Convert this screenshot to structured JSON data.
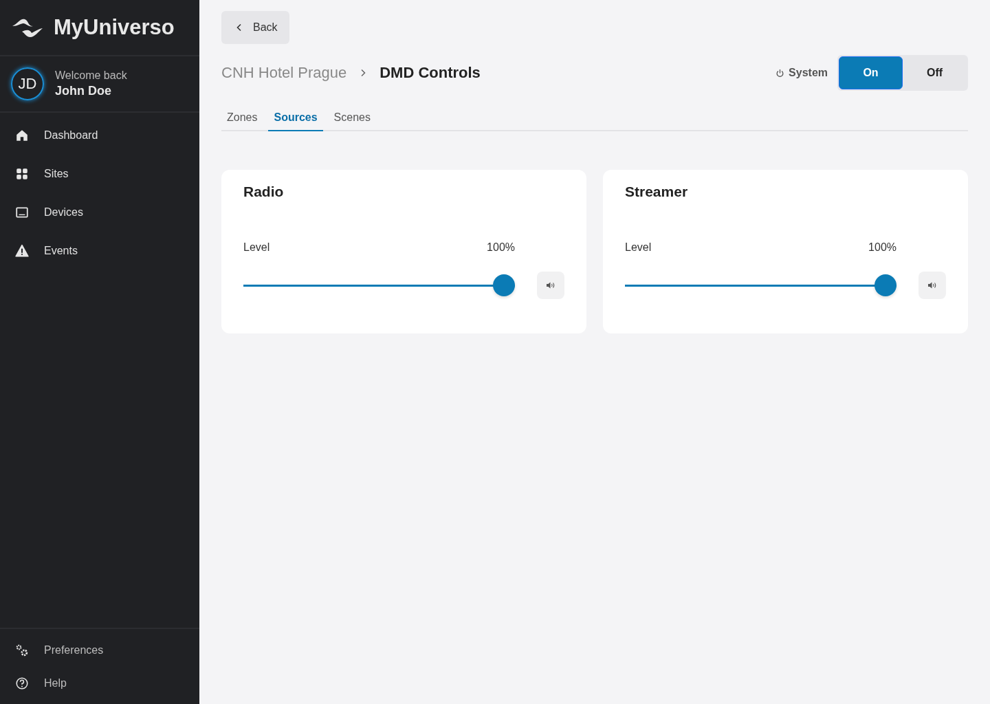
{
  "sidebar": {
    "brand": "MyUniverso",
    "user": {
      "initials": "JD",
      "greeting": "Welcome back",
      "name": "John Doe"
    },
    "items": [
      {
        "label": "Dashboard",
        "kind": "home",
        "selected": false
      },
      {
        "label": "Sites",
        "kind": "grid",
        "selected": false
      },
      {
        "label": "Devices",
        "kind": "device",
        "selected": false
      },
      {
        "label": "Events",
        "kind": "warning",
        "selected": false
      }
    ],
    "footer_items": [
      {
        "label": "Preferences",
        "kind": "gears"
      },
      {
        "label": "Help",
        "kind": "help"
      }
    ]
  },
  "back_button": "Back",
  "breadcrumb": [
    {
      "label": "CNH Hotel Prague",
      "current": false
    },
    {
      "label": "DMD Controls",
      "current": true
    }
  ],
  "system": {
    "label": "System",
    "options": [
      {
        "label": "On",
        "selected": true
      },
      {
        "label": "Off",
        "selected": false
      }
    ]
  },
  "tabs": [
    {
      "label": "Zones",
      "selected": false
    },
    {
      "label": "Sources",
      "selected": true
    },
    {
      "label": "Scenes",
      "selected": false
    }
  ],
  "sources": [
    {
      "name": "Radio",
      "level_label": "Level",
      "reading": "100%",
      "level": 1.0,
      "muted": false
    },
    {
      "name": "Streamer",
      "level_label": "Level",
      "reading": "100%",
      "level": 1.0,
      "muted": false
    }
  ]
}
